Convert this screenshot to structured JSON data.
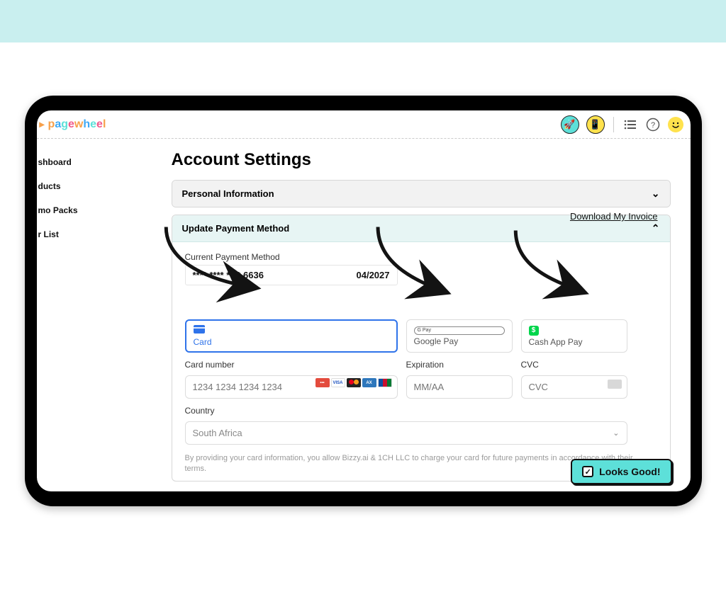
{
  "brand": {
    "logo_letters": [
      {
        "t": "p",
        "c": "#f7a04b"
      },
      {
        "t": "a",
        "c": "#3fa9f5"
      },
      {
        "t": "g",
        "c": "#5de0d9"
      },
      {
        "t": "e",
        "c": "#f05a8c"
      },
      {
        "t": "w",
        "c": "#f7a04b"
      },
      {
        "t": "h",
        "c": "#3fa9f5"
      },
      {
        "t": "e",
        "c": "#5de0d9"
      },
      {
        "t": "e",
        "c": "#f05a8c"
      },
      {
        "t": "l",
        "c": "#f7a04b"
      }
    ]
  },
  "header_icons": {
    "rocket": "🚀",
    "phone": "📱",
    "list": "≡",
    "help": "?",
    "smiley": "☺"
  },
  "sidebar": {
    "items": [
      {
        "label": "shboard"
      },
      {
        "label": "ducts"
      },
      {
        "label": "mo Packs"
      },
      {
        "label": "r List"
      }
    ]
  },
  "page": {
    "title": "Account Settings"
  },
  "sections": {
    "personal": {
      "title": "Personal Information"
    },
    "payment": {
      "title": "Update Payment Method"
    }
  },
  "payment": {
    "current_label": "Current Payment Method",
    "masked_card": "**** **** **** 6636",
    "exp_display": "04/2027",
    "invoice_link": "Download My Invoice",
    "tabs": {
      "card": "Card",
      "gpay": "Google Pay",
      "gpay_badge": "G Pay",
      "cashapp": "Cash App Pay"
    },
    "fields": {
      "cardnum_label": "Card number",
      "cardnum_placeholder": "1234 1234 1234 1234",
      "exp_label": "Expiration",
      "exp_placeholder": "MM/AA",
      "cvc_label": "CVC",
      "cvc_placeholder": "CVC",
      "country_label": "Country",
      "country_value": "South Africa"
    },
    "card_logo_labels": {
      "visa": "VISA",
      "amex": "AX"
    },
    "disclaimer": "By providing your card information, you allow Bizzy.ai & 1CH LLC to charge your card for future payments in accordance with their terms.",
    "looks_good": "Looks Good!"
  }
}
